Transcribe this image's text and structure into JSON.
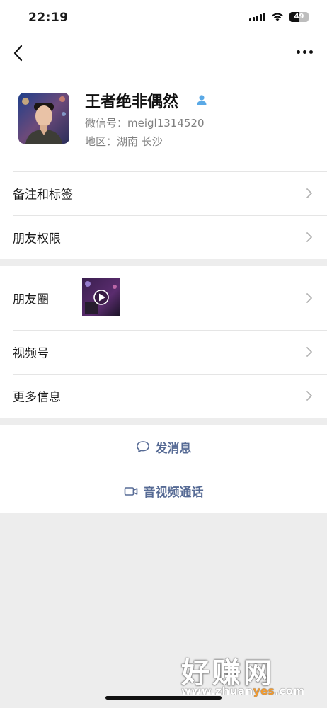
{
  "status_bar": {
    "time": "22:19",
    "battery": "49",
    "battery_level": 0.49
  },
  "nav": {
    "back_icon": "chevron-left-icon",
    "more_icon": "ellipsis-icon"
  },
  "profile": {
    "name": "王者绝非偶然",
    "wechat_id": "微信号：meigl1314520",
    "region": "地区：湖南 长沙",
    "contact_icon": "person-icon"
  },
  "menu": {
    "remark_tags": "备注和标签",
    "friend_permissions": "朋友权限",
    "moments": "朋友圈",
    "channels": "视频号",
    "more_info": "更多信息"
  },
  "actions": {
    "send_message": "发消息",
    "video_call": "音视频通话"
  },
  "watermark": {
    "brand": "好赚网",
    "url_prefix": "www.zhuan",
    "url_highlight": "yes",
    "url_suffix": ".com"
  },
  "colors": {
    "link": "#576b95",
    "background": "#ededed",
    "contact_icon": "#5aa9e6",
    "watermark_highlight": "#f29a2e"
  }
}
